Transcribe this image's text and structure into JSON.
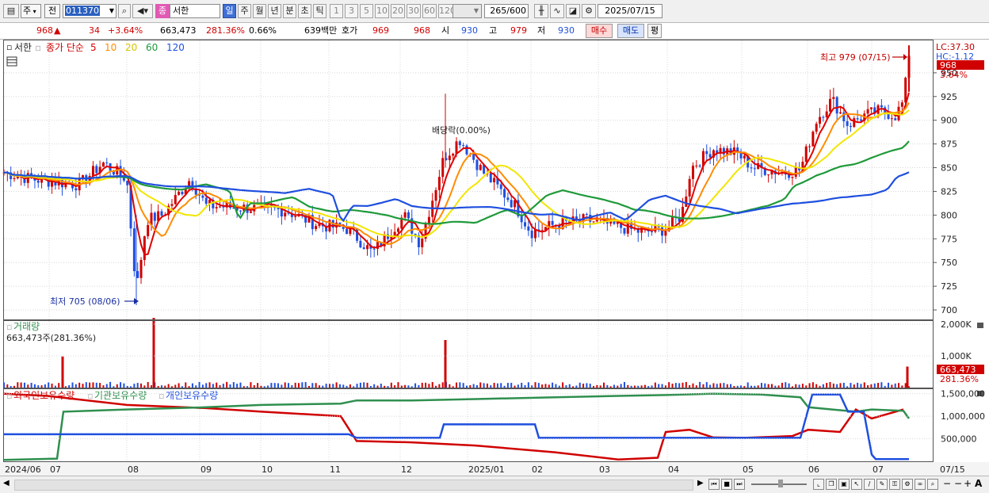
{
  "toolbar": {
    "market_label": "주",
    "prev_label": "전",
    "code": "011370",
    "stock_name_badge": "종",
    "stock_name": "서한",
    "period_active": "일",
    "period_buttons": [
      "주",
      "월",
      "년",
      "분",
      "초",
      "틱"
    ],
    "interval_buttons": [
      "1",
      "3",
      "5",
      "10",
      "20",
      "30",
      "60",
      "120"
    ],
    "count": "265",
    "count_total": "/600",
    "date": "2025/07/15"
  },
  "quote": {
    "price": "968",
    "change_arrow": "▲",
    "change": "34",
    "change_pct": "+3.64%",
    "volume": "663,473",
    "volume_ratio": "281.36%",
    "turnover": "0.66%",
    "amount": "639백만",
    "hoga_label": "호가",
    "bid1": "969",
    "bid2": "968",
    "open_label": "시",
    "open": "930",
    "high_label": "고",
    "high": "979",
    "low_label": "저",
    "low": "930",
    "buy_label": "매수",
    "sell_label": "매도",
    "eval_label": "평"
  },
  "price_panel": {
    "stock_label": "서한",
    "indicator_label": "종가 단순",
    "ma_periods": [
      "5",
      "10",
      "20",
      "60",
      "120"
    ],
    "ma_colors": [
      "#e00000",
      "#ff8c00",
      "#f2e600",
      "#1f9a3a",
      "#1f4fdf"
    ],
    "lc_label": "LC:37.30",
    "hc_label": "HC:-1.12",
    "current_price_tag": "968",
    "current_pct_tag": "3.64%",
    "high_annotation": "최고 979 (07/15)",
    "low_annotation": "최저 705 (08/06)",
    "dividend_annotation": "배당락(0.00%)",
    "y_ticks": [
      "950",
      "925",
      "900",
      "875",
      "850",
      "825",
      "800",
      "775",
      "750",
      "725",
      "700"
    ]
  },
  "volume_panel": {
    "title": "거래량",
    "value_label": "663,473주(281.36%)",
    "y_ticks": [
      "2,000K",
      "1,000K"
    ],
    "current_tag": "663,473",
    "current_pct_tag": "281.36%"
  },
  "holdings_panel": {
    "legend": [
      "외국인보유수량",
      "기관보유수량",
      "개인보유수량"
    ],
    "legend_colors": [
      "#d00000",
      "#2f8f4f",
      "#1f4fdf"
    ],
    "y_ticks": [
      "1,500,000",
      "1,000,000",
      "500,000"
    ]
  },
  "x_axis": {
    "labels": [
      "2024/06",
      "07",
      "08",
      "09",
      "10",
      "11",
      "12",
      "2025/01",
      "02",
      "03",
      "04",
      "05",
      "06",
      "07"
    ],
    "right_label": "07/15"
  },
  "chart_data": {
    "type": "line",
    "title": "",
    "price_high": 979,
    "price_high_date": "07/15",
    "price_low": 705,
    "price_low_date": "08/06",
    "ylim": [
      690,
      985
    ],
    "closing_price_monthly": {
      "x": [
        "2024/06",
        "07",
        "08",
        "09",
        "10",
        "11",
        "12",
        "2025/01",
        "02",
        "03",
        "04",
        "05",
        "06",
        "07"
      ],
      "values": [
        845,
        855,
        790,
        830,
        810,
        770,
        800,
        860,
        790,
        790,
        850,
        840,
        900,
        968
      ]
    },
    "volume_ylim": [
      0,
      2000000
    ],
    "volume_spikes_k": [
      {
        "x": "07",
        "v": 980
      },
      {
        "x": "08",
        "v": 2200
      },
      {
        "x": "12",
        "v": 1500
      },
      {
        "x": "07/15",
        "v": 663
      }
    ],
    "holdings_ylim": [
      0,
      1600000
    ],
    "holdings_series": [
      {
        "name": "외국인보유수량",
        "x": [
          "2024/06",
          "07",
          "08",
          "09",
          "10",
          "11",
          "12",
          "2025/01",
          "02",
          "03",
          "04",
          "05",
          "06",
          "07"
        ],
        "values": [
          1500000,
          1400000,
          1200000,
          1150000,
          1050000,
          450000,
          400000,
          380000,
          250000,
          70000,
          650000,
          500000,
          700000,
          1150000
        ]
      },
      {
        "name": "기관보유수량",
        "x": [
          "2024/06",
          "07",
          "08",
          "09",
          "10",
          "11",
          "12",
          "2025/01",
          "02",
          "03",
          "04",
          "05",
          "06",
          "07"
        ],
        "values": [
          30000,
          1150000,
          1200000,
          1220000,
          1250000,
          1300000,
          1320000,
          1350000,
          1400000,
          1420000,
          1450000,
          1480000,
          1200000,
          1000000
        ]
      },
      {
        "name": "개인보유수량",
        "x": [
          "2024/06",
          "07",
          "08",
          "09",
          "10",
          "11",
          "12",
          "2025/01",
          "02",
          "03",
          "04",
          "05",
          "06",
          "07"
        ],
        "values": [
          600000,
          600000,
          600000,
          600000,
          600000,
          600000,
          600000,
          850000,
          550000,
          550000,
          550000,
          550000,
          1450000,
          50000
        ]
      }
    ]
  }
}
